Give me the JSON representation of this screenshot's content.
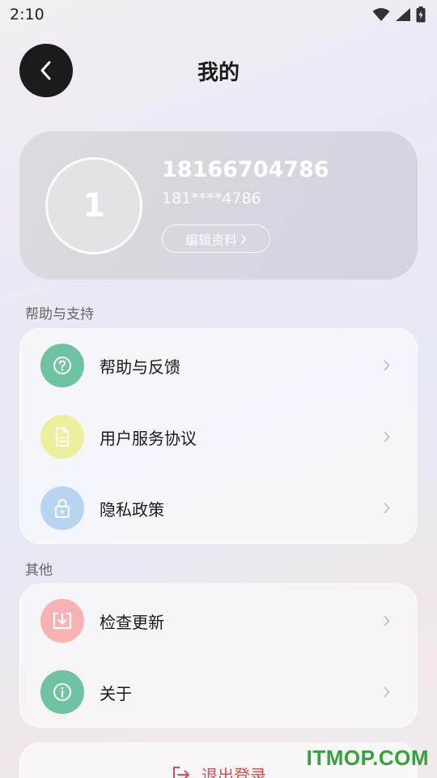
{
  "status_bar": {
    "time": "2:10"
  },
  "header": {
    "title": "我的"
  },
  "profile": {
    "avatar_text": "1",
    "name": "18166704786",
    "phone_masked": "181****4786",
    "edit_label": "编辑资料"
  },
  "sections": {
    "help": {
      "label": "帮助与支持",
      "items": [
        {
          "label": "帮助与反馈",
          "icon": "help-circle-icon",
          "color": "#6ec4a0"
        },
        {
          "label": "用户服务协议",
          "icon": "document-icon",
          "color": "#ecf09a"
        },
        {
          "label": "隐私政策",
          "icon": "lock-icon",
          "color": "#b7d4f0"
        }
      ]
    },
    "other": {
      "label": "其他",
      "items": [
        {
          "label": "检查更新",
          "icon": "download-icon",
          "color": "#f7b3b3"
        },
        {
          "label": "关于",
          "icon": "info-icon",
          "color": "#6ec4a0"
        }
      ]
    }
  },
  "logout": {
    "label": "退出登录",
    "color": "#e04a4a"
  },
  "watermark": {
    "text": "ITMOP.COM"
  }
}
